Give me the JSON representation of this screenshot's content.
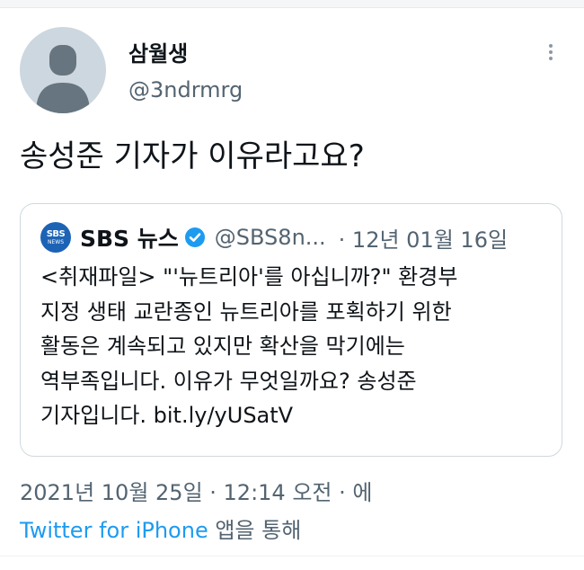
{
  "tweet": {
    "display_name": "삼월생",
    "handle": "@3ndrmrg",
    "text": "송성준 기자가 이유라고요?",
    "timestamp": "2021년 10월 25일 · 12:14 오전 · 에",
    "source_app": "Twitter for iPhone",
    "source_suffix": " 앱을 통해"
  },
  "quoted": {
    "logo_top": "SBS",
    "logo_bottom": "NEWS",
    "name": "SBS 뉴스",
    "handle": "@SBS8n...",
    "date": "· 12년 01월 16일",
    "lines": [
      "<취재파일> \"'뉴트리아'를 아십니까?\" 환경부",
      "지정 생태 교란종인 뉴트리아를 포획하기 위한",
      "활동은 계속되고 있지만 확산을 막기에는",
      "역부족입니다. 이유가 무엇일까요? 송성준",
      "기자입니다. bit.ly/yUSatV"
    ]
  },
  "colors": {
    "link": "#1d9bf0",
    "secondary": "#536471",
    "verified": "#1d9bf0",
    "logo": "#1d63b5"
  },
  "icons": {
    "more": "more-vertical-icon",
    "verified": "verified-badge-icon",
    "avatar": "default-avatar-icon"
  }
}
